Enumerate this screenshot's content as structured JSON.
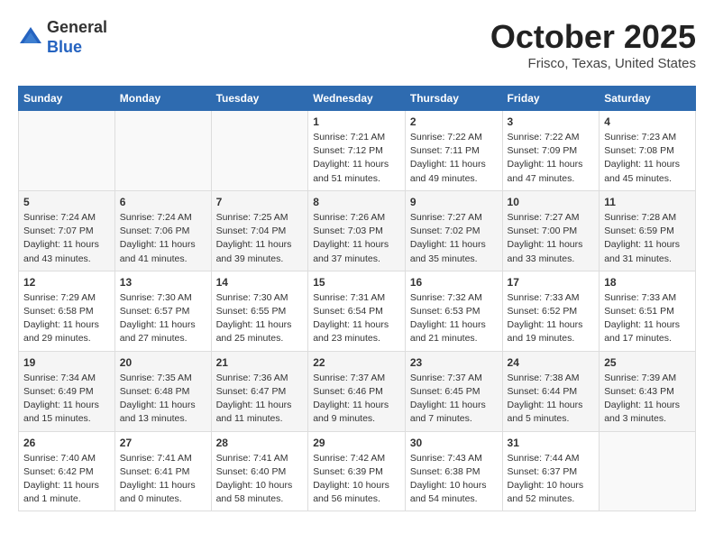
{
  "header": {
    "logo_line1": "General",
    "logo_line2": "Blue",
    "month": "October 2025",
    "location": "Frisco, Texas, United States"
  },
  "weekdays": [
    "Sunday",
    "Monday",
    "Tuesday",
    "Wednesday",
    "Thursday",
    "Friday",
    "Saturday"
  ],
  "weeks": [
    [
      {
        "day": "",
        "info": ""
      },
      {
        "day": "",
        "info": ""
      },
      {
        "day": "",
        "info": ""
      },
      {
        "day": "1",
        "info": "Sunrise: 7:21 AM\nSunset: 7:12 PM\nDaylight: 11 hours\nand 51 minutes."
      },
      {
        "day": "2",
        "info": "Sunrise: 7:22 AM\nSunset: 7:11 PM\nDaylight: 11 hours\nand 49 minutes."
      },
      {
        "day": "3",
        "info": "Sunrise: 7:22 AM\nSunset: 7:09 PM\nDaylight: 11 hours\nand 47 minutes."
      },
      {
        "day": "4",
        "info": "Sunrise: 7:23 AM\nSunset: 7:08 PM\nDaylight: 11 hours\nand 45 minutes."
      }
    ],
    [
      {
        "day": "5",
        "info": "Sunrise: 7:24 AM\nSunset: 7:07 PM\nDaylight: 11 hours\nand 43 minutes."
      },
      {
        "day": "6",
        "info": "Sunrise: 7:24 AM\nSunset: 7:06 PM\nDaylight: 11 hours\nand 41 minutes."
      },
      {
        "day": "7",
        "info": "Sunrise: 7:25 AM\nSunset: 7:04 PM\nDaylight: 11 hours\nand 39 minutes."
      },
      {
        "day": "8",
        "info": "Sunrise: 7:26 AM\nSunset: 7:03 PM\nDaylight: 11 hours\nand 37 minutes."
      },
      {
        "day": "9",
        "info": "Sunrise: 7:27 AM\nSunset: 7:02 PM\nDaylight: 11 hours\nand 35 minutes."
      },
      {
        "day": "10",
        "info": "Sunrise: 7:27 AM\nSunset: 7:00 PM\nDaylight: 11 hours\nand 33 minutes."
      },
      {
        "day": "11",
        "info": "Sunrise: 7:28 AM\nSunset: 6:59 PM\nDaylight: 11 hours\nand 31 minutes."
      }
    ],
    [
      {
        "day": "12",
        "info": "Sunrise: 7:29 AM\nSunset: 6:58 PM\nDaylight: 11 hours\nand 29 minutes."
      },
      {
        "day": "13",
        "info": "Sunrise: 7:30 AM\nSunset: 6:57 PM\nDaylight: 11 hours\nand 27 minutes."
      },
      {
        "day": "14",
        "info": "Sunrise: 7:30 AM\nSunset: 6:55 PM\nDaylight: 11 hours\nand 25 minutes."
      },
      {
        "day": "15",
        "info": "Sunrise: 7:31 AM\nSunset: 6:54 PM\nDaylight: 11 hours\nand 23 minutes."
      },
      {
        "day": "16",
        "info": "Sunrise: 7:32 AM\nSunset: 6:53 PM\nDaylight: 11 hours\nand 21 minutes."
      },
      {
        "day": "17",
        "info": "Sunrise: 7:33 AM\nSunset: 6:52 PM\nDaylight: 11 hours\nand 19 minutes."
      },
      {
        "day": "18",
        "info": "Sunrise: 7:33 AM\nSunset: 6:51 PM\nDaylight: 11 hours\nand 17 minutes."
      }
    ],
    [
      {
        "day": "19",
        "info": "Sunrise: 7:34 AM\nSunset: 6:49 PM\nDaylight: 11 hours\nand 15 minutes."
      },
      {
        "day": "20",
        "info": "Sunrise: 7:35 AM\nSunset: 6:48 PM\nDaylight: 11 hours\nand 13 minutes."
      },
      {
        "day": "21",
        "info": "Sunrise: 7:36 AM\nSunset: 6:47 PM\nDaylight: 11 hours\nand 11 minutes."
      },
      {
        "day": "22",
        "info": "Sunrise: 7:37 AM\nSunset: 6:46 PM\nDaylight: 11 hours\nand 9 minutes."
      },
      {
        "day": "23",
        "info": "Sunrise: 7:37 AM\nSunset: 6:45 PM\nDaylight: 11 hours\nand 7 minutes."
      },
      {
        "day": "24",
        "info": "Sunrise: 7:38 AM\nSunset: 6:44 PM\nDaylight: 11 hours\nand 5 minutes."
      },
      {
        "day": "25",
        "info": "Sunrise: 7:39 AM\nSunset: 6:43 PM\nDaylight: 11 hours\nand 3 minutes."
      }
    ],
    [
      {
        "day": "26",
        "info": "Sunrise: 7:40 AM\nSunset: 6:42 PM\nDaylight: 11 hours\nand 1 minute."
      },
      {
        "day": "27",
        "info": "Sunrise: 7:41 AM\nSunset: 6:41 PM\nDaylight: 11 hours\nand 0 minutes."
      },
      {
        "day": "28",
        "info": "Sunrise: 7:41 AM\nSunset: 6:40 PM\nDaylight: 10 hours\nand 58 minutes."
      },
      {
        "day": "29",
        "info": "Sunrise: 7:42 AM\nSunset: 6:39 PM\nDaylight: 10 hours\nand 56 minutes."
      },
      {
        "day": "30",
        "info": "Sunrise: 7:43 AM\nSunset: 6:38 PM\nDaylight: 10 hours\nand 54 minutes."
      },
      {
        "day": "31",
        "info": "Sunrise: 7:44 AM\nSunset: 6:37 PM\nDaylight: 10 hours\nand 52 minutes."
      },
      {
        "day": "",
        "info": ""
      }
    ]
  ]
}
